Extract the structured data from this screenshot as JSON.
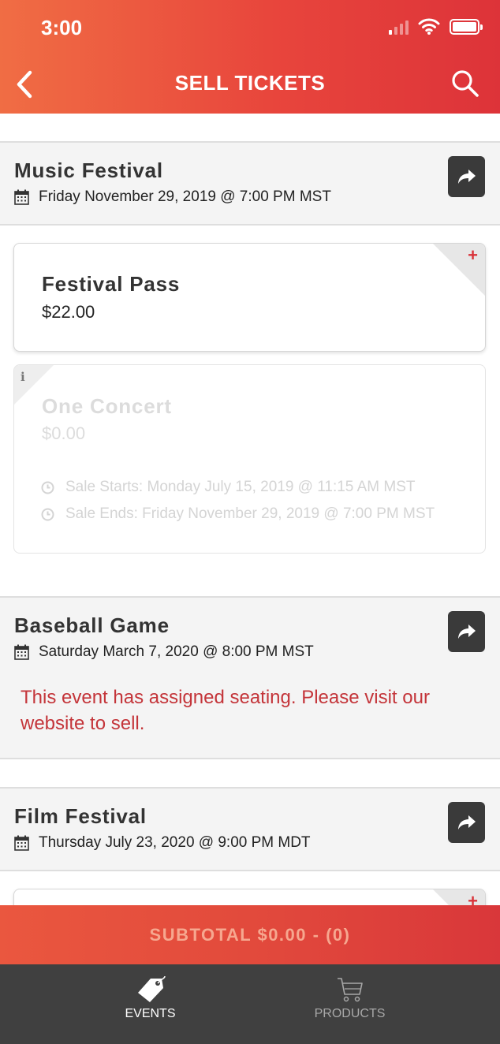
{
  "status_bar": {
    "time": "3:00"
  },
  "header": {
    "title": "SELL TICKETS",
    "back_icon": "chevron-left-icon",
    "search_icon": "search-icon",
    "gradient_start": "#f06d44",
    "gradient_end": "#dd3339"
  },
  "events": [
    {
      "name": "Music Festival",
      "date": "Friday November 29, 2019 @ 7:00 PM MST",
      "tickets": [
        {
          "name": "Festival Pass",
          "price": "$22.00",
          "available": true
        },
        {
          "name": "One Concert",
          "price": "$0.00",
          "available": false,
          "sale_starts": "Sale Starts: Monday July 15, 2019 @ 11:15 AM MST",
          "sale_ends": "Sale Ends: Friday November 29, 2019 @ 7:00 PM MST"
        }
      ]
    },
    {
      "name": "Baseball Game",
      "date": "Saturday March 7, 2020 @ 8:00 PM MST",
      "notice": "This event has assigned seating. Please visit our website to sell."
    },
    {
      "name": "Film Festival",
      "date": "Thursday July 23, 2020 @ 9:00 PM MDT",
      "tickets": [
        {
          "available": true
        }
      ]
    }
  ],
  "subtotal": {
    "label": "SUBTOTAL $0.00 - (0)"
  },
  "bottom_nav": {
    "items": [
      {
        "label": "EVENTS",
        "icon": "tag-icon",
        "active": true
      },
      {
        "label": "PRODUCTS",
        "icon": "cart-icon",
        "active": false
      }
    ]
  },
  "colors": {
    "accent": "#e24a3c",
    "notice_text": "#c4353a",
    "nav_background": "#404040",
    "share_button": "#3a3a3a"
  }
}
